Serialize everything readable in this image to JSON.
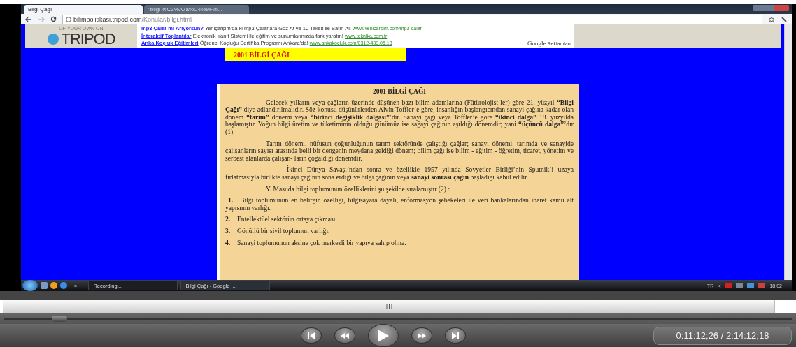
{
  "browser": {
    "tabs": [
      {
        "label": "Bilgi Çağı",
        "selected": true
      },
      {
        "label": "\"bilgi %C3%A7a%C4%9F%...",
        "selected": false
      }
    ],
    "url": {
      "host": "bilimpolitikasi.tripod.com",
      "path": "/Konular/bilgi.html"
    }
  },
  "page": {
    "banner": {
      "tagline": "OF YOUR OWN ON",
      "logo": "TRIPOD"
    },
    "ads": [
      {
        "title": "mp3 Çalar mı Arıyorsun?",
        "text": "Yeniçarşım'da ki mp3 Çalarlara Göz At ve 10 Taksit ile Satın Al!",
        "link": "www.Yenicarsim.com/mp3-calar"
      },
      {
        "title": "İnteraktif Toplantılar",
        "text": "Elektronik Yanıt Sistemi ile eğitim ve sunumlarınızda fark yaratın!",
        "link": "www.teknika.com.tr"
      },
      {
        "title": "Anka Koçluk Eğitimleri",
        "text": "Öğrenci Koçluğu Sertifika Programı Ankara'da!",
        "link": "www.ankakocluk.com/0312-439.05.13"
      }
    ],
    "ads_brand": "Google",
    "ads_label": "Reklamları",
    "header": "2001 BİLGİ ÇAĞI",
    "article": {
      "title": "2001 BİLGİ ÇAĞI",
      "paragraphs": [
        "Gelecek yılların veya çağların üzerinde düşünen bazı bilim adamlarına (Fütürolojist-ler) göre 21. yüzyıl **“Bilgi Çağı”** diye adlandırılmalıdır. Söz konusu düşünürlerden Alvin Toffler’e göre, insanlığın başlangıcından sanayi çağına kadar olan dönem **“tarım”** dönemi veya **“birinci değişiklik dalgası”**’dır. Sanayi çağı veya Toffler’e göre **“ikinci dalga”** 18. yüzyılda başlamıştır. Yoğun bilgi üretim ve tüketiminin olduğu günümüz ise sağayi çağının aşıldığı dönemdir; yani **“üçüncü dalga”**’dır (1).",
        "Tarım dönemi, nüfusun çoğunluğunun tarım sektöründe çalıştığı çağlar; sanayi dönemi, tarımda ve sanayide çalışanların sayısı arasında belli bir dengenin meydana geldiği dönem; bilim çağı ise bilim - eğitim - öğretim, ticaret, yönetim ve serbest alanlarda çalışan- ların çoğaldığı dönemdir.",
        "İkinci Dünya Savaşı’ndan sonra ve özellikle 1957 yılında Sovyetler Birliği’nin Sputnik’i uzaya fırlatmasıyla birlikte sanayi çağının sona erdiği ve bilgi çağının veya **sanayi sonrası çağın** başladığı kabul edilir.",
        "Y. Masuda bilgi toplumunun özelliklerini şu şekilde sıralamıştır (2) :"
      ],
      "list": [
        {
          "number": "1.",
          "text": "Bilgi toplumunun en belirgin özelliği, bilgisayara dayalı, enformasyon şebekeleri ile veri bankalarından ibaret kamu alt yapısının varlığı."
        },
        {
          "number": "2.",
          "text": "Entellektüel sektörün ortaya çıkması."
        },
        {
          "number": "3.",
          "text": "Gönüllü bir sivil toplumun varlığı."
        },
        {
          "number": "4.",
          "text": "Sanayi toplumunun aksine çok merkezli bir yapıya sahip olma."
        }
      ]
    }
  },
  "taskbar": {
    "more": "»",
    "buttons": [
      {
        "label": "Recording...",
        "selected": false
      },
      {
        "label": "Bilgi Çağı - Google ...",
        "selected": true
      }
    ],
    "language": "TR",
    "expand": "<",
    "clock": "18:02"
  },
  "player": {
    "seek": {
      "level": 0.07
    },
    "time": "0:11:12;26 / 2:14:12;18"
  }
}
